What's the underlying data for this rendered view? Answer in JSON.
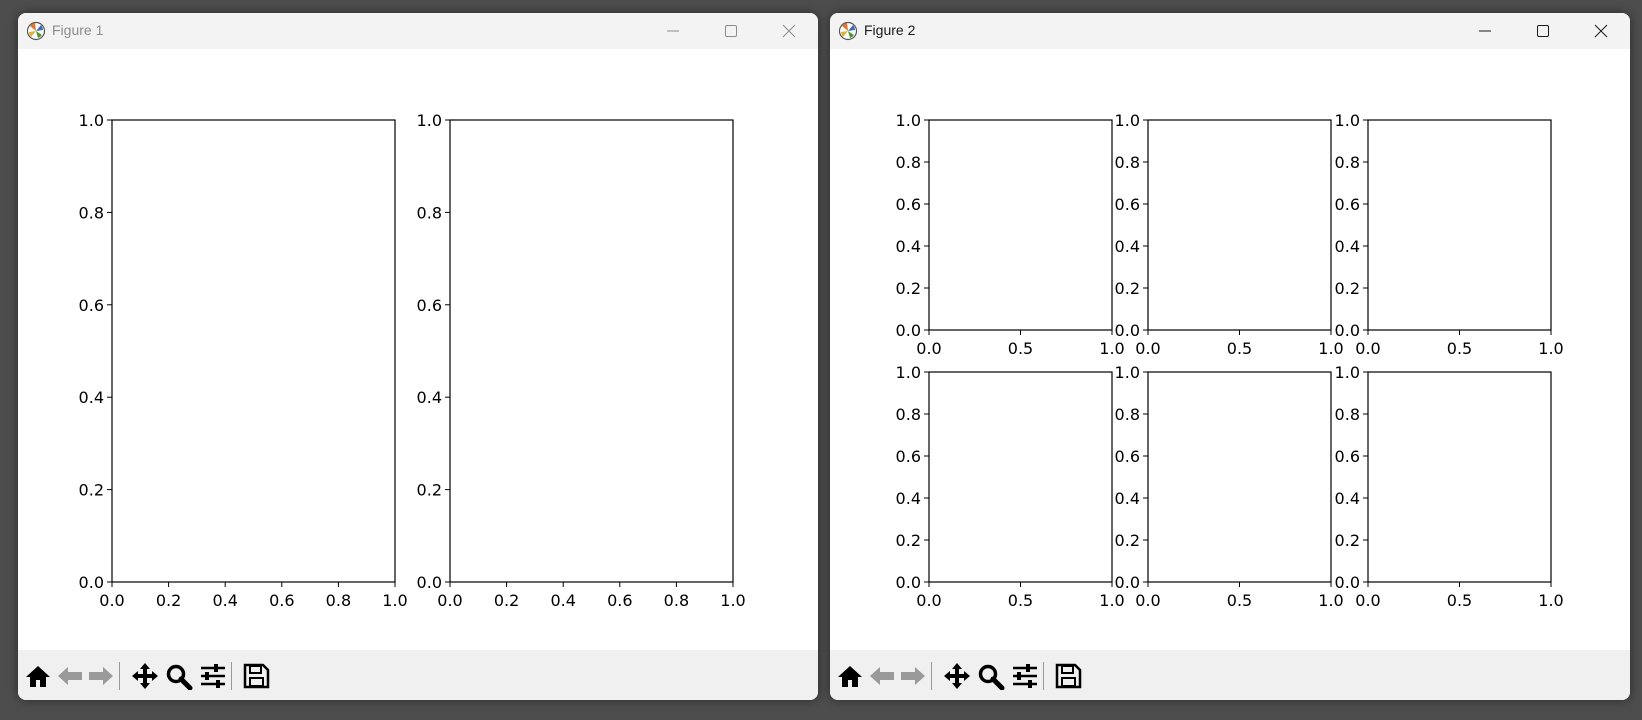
{
  "windows": [
    {
      "title": "Figure 1",
      "subplots": {
        "rows": 1,
        "cols": 2,
        "axes": [
          {
            "xlim": [
              0.0,
              1.0
            ],
            "ylim": [
              0.0,
              1.0
            ],
            "xticklabels": [
              "0.0",
              "0.2",
              "0.4",
              "0.6",
              "0.8",
              "1.0"
            ],
            "yticklabels": [
              "0.0",
              "0.2",
              "0.4",
              "0.6",
              "0.8",
              "1.0"
            ]
          },
          {
            "xlim": [
              0.0,
              1.0
            ],
            "ylim": [
              0.0,
              1.0
            ],
            "xticklabels": [
              "0.0",
              "0.2",
              "0.4",
              "0.6",
              "0.8",
              "1.0"
            ],
            "yticklabels": [
              "0.0",
              "0.2",
              "0.4",
              "0.6",
              "0.8",
              "1.0"
            ]
          }
        ]
      }
    },
    {
      "title": "Figure 2",
      "subplots": {
        "rows": 2,
        "cols": 3,
        "axes": [
          {
            "xlim": [
              0.0,
              1.0
            ],
            "ylim": [
              0.0,
              1.0
            ],
            "xticklabels": [
              "0.0",
              "0.5",
              "1.0"
            ],
            "yticklabels": [
              "0.0",
              "0.2",
              "0.4",
              "0.6",
              "0.8",
              "1.0"
            ]
          },
          {
            "xlim": [
              0.0,
              1.0
            ],
            "ylim": [
              0.0,
              1.0
            ],
            "xticklabels": [
              "0.0",
              "0.5",
              "1.0"
            ],
            "yticklabels": [
              "0.0",
              "0.2",
              "0.4",
              "0.6",
              "0.8",
              "1.0"
            ]
          },
          {
            "xlim": [
              0.0,
              1.0
            ],
            "ylim": [
              0.0,
              1.0
            ],
            "xticklabels": [
              "0.0",
              "0.5",
              "1.0"
            ],
            "yticklabels": [
              "0.0",
              "0.2",
              "0.4",
              "0.6",
              "0.8",
              "1.0"
            ]
          },
          {
            "xlim": [
              0.0,
              1.0
            ],
            "ylim": [
              0.0,
              1.0
            ],
            "xticklabels": [
              "0.0",
              "0.5",
              "1.0"
            ],
            "yticklabels": [
              "0.0",
              "0.2",
              "0.4",
              "0.6",
              "0.8",
              "1.0"
            ]
          },
          {
            "xlim": [
              0.0,
              1.0
            ],
            "ylim": [
              0.0,
              1.0
            ],
            "xticklabels": [
              "0.0",
              "0.5",
              "1.0"
            ],
            "yticklabels": [
              "0.0",
              "0.2",
              "0.4",
              "0.6",
              "0.8",
              "1.0"
            ]
          },
          {
            "xlim": [
              0.0,
              1.0
            ],
            "ylim": [
              0.0,
              1.0
            ],
            "xticklabels": [
              "0.0",
              "0.5",
              "1.0"
            ],
            "yticklabels": [
              "0.0",
              "0.2",
              "0.4",
              "0.6",
              "0.8",
              "1.0"
            ]
          }
        ]
      }
    }
  ],
  "toolbar_buttons": [
    {
      "name": "home",
      "icon": "home-icon",
      "enabled": true
    },
    {
      "name": "back",
      "icon": "arrow-left-icon",
      "enabled": false
    },
    {
      "name": "forward",
      "icon": "arrow-right-icon",
      "enabled": false
    },
    {
      "name": "pan",
      "icon": "move-icon",
      "enabled": true
    },
    {
      "name": "zoom",
      "icon": "magnifier-icon",
      "enabled": true
    },
    {
      "name": "subplots",
      "icon": "sliders-icon",
      "enabled": true
    },
    {
      "name": "save",
      "icon": "floppy-disk-icon",
      "enabled": true
    }
  ],
  "chart_data": [
    {
      "type": "scatter",
      "figure": "Figure 1",
      "layout": "1x2",
      "series": [],
      "xlim": [
        0.0,
        1.0
      ],
      "ylim": [
        0.0,
        1.0
      ],
      "xticks": [
        0.0,
        0.2,
        0.4,
        0.6,
        0.8,
        1.0
      ],
      "yticks": [
        0.0,
        0.2,
        0.4,
        0.6,
        0.8,
        1.0
      ],
      "grid": false
    },
    {
      "type": "scatter",
      "figure": "Figure 2",
      "layout": "2x3",
      "series": [],
      "xlim": [
        0.0,
        1.0
      ],
      "ylim": [
        0.0,
        1.0
      ],
      "xticks": [
        0.0,
        0.5,
        1.0
      ],
      "yticks": [
        0.0,
        0.2,
        0.4,
        0.6,
        0.8,
        1.0
      ],
      "grid": false
    }
  ],
  "colors": {
    "axes": "#000000",
    "toolbar_bg": "#f0f0f0",
    "titlebar_bg": "#f3f3f3",
    "desktop_bg": "#4d4d4d",
    "disabled_icon": "#9a9a9a"
  }
}
